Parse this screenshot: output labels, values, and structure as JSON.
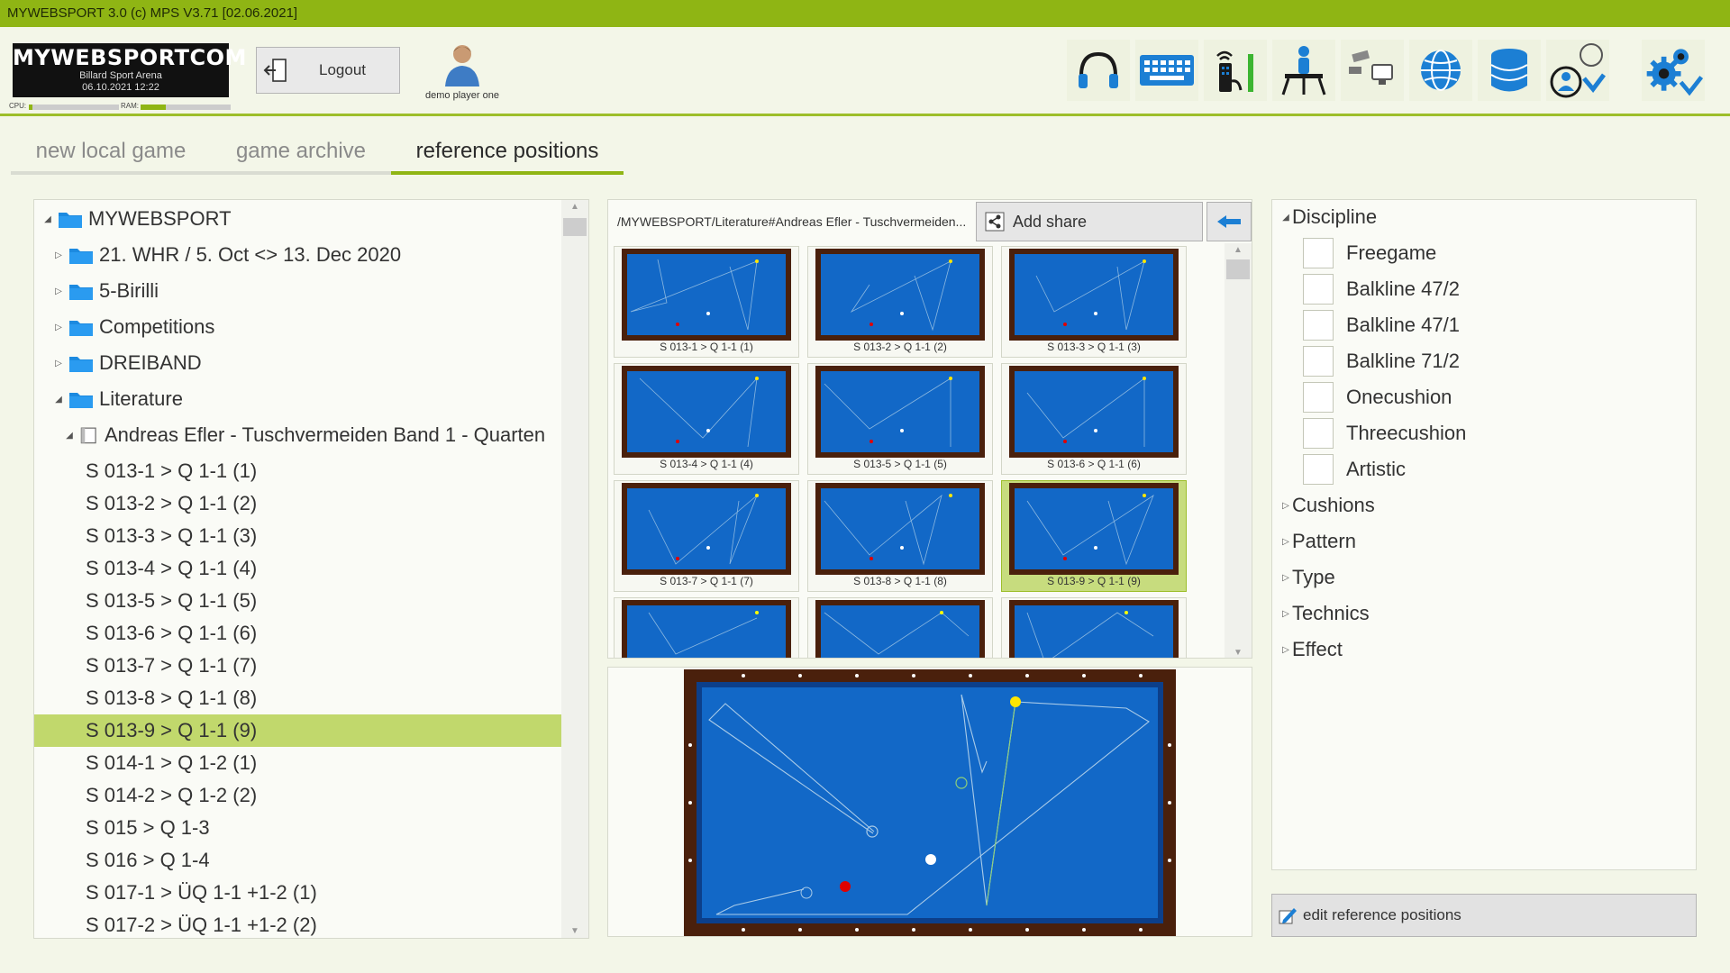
{
  "window": {
    "title": "MYWEBSPORT 3.0  (c) MPS V3.71 [02.06.2021]"
  },
  "branding": {
    "logo_text": "MYWEBSPORTCOM",
    "venue": "Billard Sport Arena",
    "datetime": "06.10.2021  12:22",
    "cpu_label": "CPU:",
    "ram_label": "RAM:",
    "cpu_usage_percent": 4,
    "ram_usage_percent": 28
  },
  "header": {
    "logout_label": "Logout",
    "user_name": "demo player one",
    "tools": [
      "headphones-icon",
      "keyboard-icon",
      "remote-signal-icon",
      "presenter-icon",
      "camera-display-icon",
      "globe-icon",
      "database-icon",
      "user-check-icon",
      "settings-check-icon"
    ]
  },
  "tabs": [
    {
      "label": "new local game",
      "active": false
    },
    {
      "label": "game archive",
      "active": false
    },
    {
      "label": "reference positions",
      "active": true
    }
  ],
  "tree": {
    "root": "MYWEBSPORT",
    "folders": [
      "21. WHR / 5. Oct <> 13. Dec 2020",
      "5-Birilli",
      "Competitions",
      "DREIBAND",
      "Literature"
    ],
    "book": "Andreas Efler - Tuschvermeiden Band 1 - Quarten",
    "items": [
      "S 013-1 > Q 1-1 (1)",
      "S 013-2 > Q 1-1 (2)",
      "S 013-3 > Q 1-1 (3)",
      "S 013-4 > Q 1-1 (4)",
      "S 013-5 > Q 1-1 (5)",
      "S 013-6 > Q 1-1 (6)",
      "S 013-7 > Q 1-1 (7)",
      "S 013-8 > Q 1-1 (8)",
      "S 013-9 > Q 1-1 (9)",
      "S 014-1 > Q 1-2 (1)",
      "S 014-2 > Q 1-2 (2)",
      "S 015 > Q 1-3",
      "S 016 > Q 1-4",
      "S 017-1 > ÜQ 1-1 +1-2 (1)",
      "S 017-2 > ÜQ 1-1 +1-2 (2)"
    ],
    "selected_index": 8
  },
  "gallery": {
    "path": "/MYWEBSPORT/Literature#Andreas Efler - Tuschvermeiden...",
    "share_label": "Add share",
    "thumbnails": [
      "S 013-1 > Q 1-1 (1)",
      "S 013-2 > Q 1-1 (2)",
      "S 013-3 > Q 1-1 (3)",
      "S 013-4 > Q 1-1 (4)",
      "S 013-5 > Q 1-1 (5)",
      "S 013-6 > Q 1-1 (6)",
      "S 013-7 > Q 1-1 (7)",
      "S 013-8 > Q 1-1 (8)",
      "S 013-9 > Q 1-1 (9)"
    ],
    "selected_index": 8
  },
  "filters": {
    "discipline_label": "Discipline",
    "disciplines": [
      "Freegame",
      "Balkline 47/2",
      "Balkline 47/1",
      "Balkline 71/2",
      "Onecushion",
      "Threecushion",
      "Artistic"
    ],
    "groups": [
      "Cushions",
      "Pattern",
      "Type",
      "Technics",
      "Effect"
    ]
  },
  "actions": {
    "edit_label": "edit reference positions"
  },
  "colors": {
    "accent": "#8fb514",
    "selection": "#c1d86c",
    "table_cloth": "#1268c7",
    "table_rail": "#4a200c"
  }
}
